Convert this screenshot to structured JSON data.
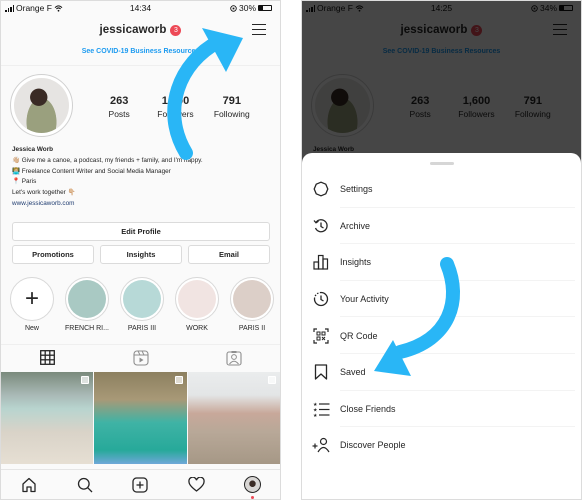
{
  "left_phone": {
    "status_bar": {
      "carrier": "Orange F",
      "time": "14:34",
      "battery": "30%",
      "battery_level": 0.3
    },
    "header": {
      "username": "jessicaworb",
      "notification_count": "3"
    },
    "covid_link": "See COVID-19 Business Resources",
    "stats": [
      {
        "value": "263",
        "label": "Posts"
      },
      {
        "value": "1,600",
        "label": "Followers"
      },
      {
        "value": "791",
        "label": "Following"
      }
    ],
    "bio": {
      "name": "Jessica Worb",
      "lines": [
        "👋🏼 Give me a canoe, a podcast, my friends + family, and I'm happy.",
        "👩🏼‍💻 Freelance Content Writer and Social Media Manager",
        "📍 Paris",
        "Let's work together 👇🏼"
      ],
      "website": "www.jessicaworb.com"
    },
    "buttons": {
      "edit_profile": "Edit Profile",
      "promotions": "Promotions",
      "insights": "Insights",
      "email": "Email"
    },
    "highlights": [
      {
        "label": "New",
        "type": "new",
        "color": "#ffffff"
      },
      {
        "label": "FRENCH RI...",
        "type": "story",
        "color": "#a9c9c3"
      },
      {
        "label": "PARIS III",
        "type": "story",
        "color": "#b7d9d7"
      },
      {
        "label": "WORK",
        "type": "story",
        "color": "#f1e4e2"
      },
      {
        "label": "PARIS II",
        "type": "story",
        "color": "#dccfc8"
      }
    ],
    "tabs": [
      {
        "name": "grid",
        "icon": "grid-icon",
        "active": true
      },
      {
        "name": "reels",
        "icon": "reels-icon",
        "active": false
      },
      {
        "name": "tagged",
        "icon": "tagged-icon",
        "active": false
      }
    ],
    "posts": [
      {
        "description": "Woman in swimsuit at beach with cliffs",
        "multi": true
      },
      {
        "description": "Turquoise gorge river with swimmers",
        "multi": true
      },
      {
        "description": "Woman in hat sitting on rocks above town",
        "multi": true
      }
    ],
    "bottom_nav": [
      "home",
      "search",
      "new-post",
      "activity",
      "profile"
    ]
  },
  "right_phone": {
    "status_bar": {
      "carrier": "Orange F",
      "time": "14:25",
      "battery": "34%",
      "battery_level": 0.34
    },
    "header": {
      "username": "jessicaworb",
      "notification_count": "3"
    },
    "covid_link": "See COVID-19 Business Resources",
    "stats": [
      {
        "value": "263",
        "label": "Posts"
      },
      {
        "value": "1,600",
        "label": "Followers"
      },
      {
        "value": "791",
        "label": "Following"
      }
    ],
    "bio_name": "Jessica Worb",
    "menu": [
      {
        "label": "Settings",
        "icon": "settings-icon"
      },
      {
        "label": "Archive",
        "icon": "archive-icon"
      },
      {
        "label": "Insights",
        "icon": "insights-icon"
      },
      {
        "label": "Your Activity",
        "icon": "activity-icon"
      },
      {
        "label": "QR Code",
        "icon": "qr-code-icon"
      },
      {
        "label": "Saved",
        "icon": "bookmark-icon"
      },
      {
        "label": "Close Friends",
        "icon": "close-friends-icon"
      },
      {
        "label": "Discover People",
        "icon": "discover-people-icon"
      }
    ]
  },
  "annotation": {
    "arrow_color": "#29b6f6"
  }
}
